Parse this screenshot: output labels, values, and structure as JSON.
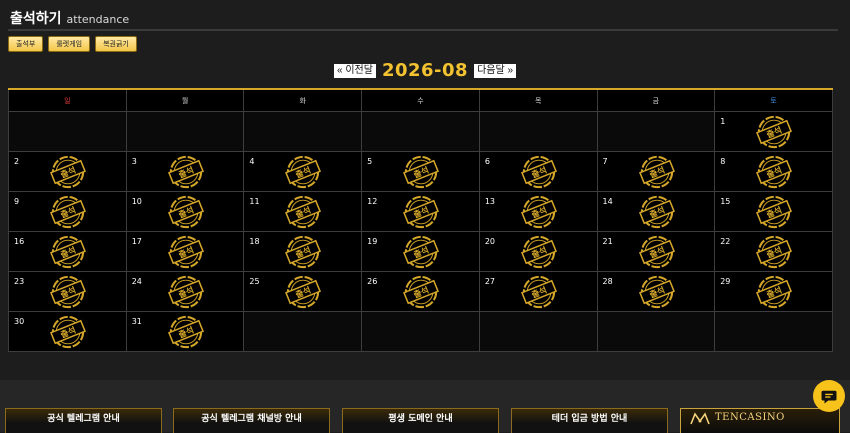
{
  "header": {
    "title": "출석하기",
    "subtitle": "attendance"
  },
  "tabs": [
    {
      "label": "출석부"
    },
    {
      "label": "룰렛게임"
    },
    {
      "label": "복권긁기"
    }
  ],
  "month_nav": {
    "prev_label": "« 이전달",
    "month": "2026-08",
    "next_label": "다음달 »"
  },
  "calendar": {
    "weekdays": [
      "일",
      "월",
      "화",
      "수",
      "목",
      "금",
      "토"
    ],
    "weeks": [
      [
        null,
        null,
        null,
        null,
        null,
        null,
        1
      ],
      [
        2,
        3,
        4,
        5,
        6,
        7,
        8
      ],
      [
        9,
        10,
        11,
        12,
        13,
        14,
        15
      ],
      [
        16,
        17,
        18,
        19,
        20,
        21,
        22
      ],
      [
        23,
        24,
        25,
        26,
        27,
        28,
        29
      ],
      [
        30,
        31,
        null,
        null,
        null,
        null,
        null
      ]
    ],
    "attended_days": [
      1,
      2,
      3,
      4,
      5,
      6,
      7,
      8,
      9,
      10,
      11,
      12,
      13,
      14,
      15,
      16,
      17,
      18,
      19,
      20,
      21,
      22,
      23,
      24,
      25,
      26,
      27,
      28,
      29,
      30,
      31
    ],
    "stamp_label": "출석",
    "colors": {
      "stamp": "#d4a62a",
      "sunday": "#e23b3b",
      "saturday": "#3c8de0",
      "accent": "#f2c230"
    }
  },
  "banners": [
    {
      "label": "공식 텔레그램 안내"
    },
    {
      "label": "공식 텔레그램 채널방 안내"
    },
    {
      "label": "평생 도메인 안내"
    },
    {
      "label": "테더 입금 방법 안내"
    }
  ],
  "brand": {
    "name": "TENCASINO"
  },
  "chat": {
    "icon": "chat-bubble-icon"
  }
}
